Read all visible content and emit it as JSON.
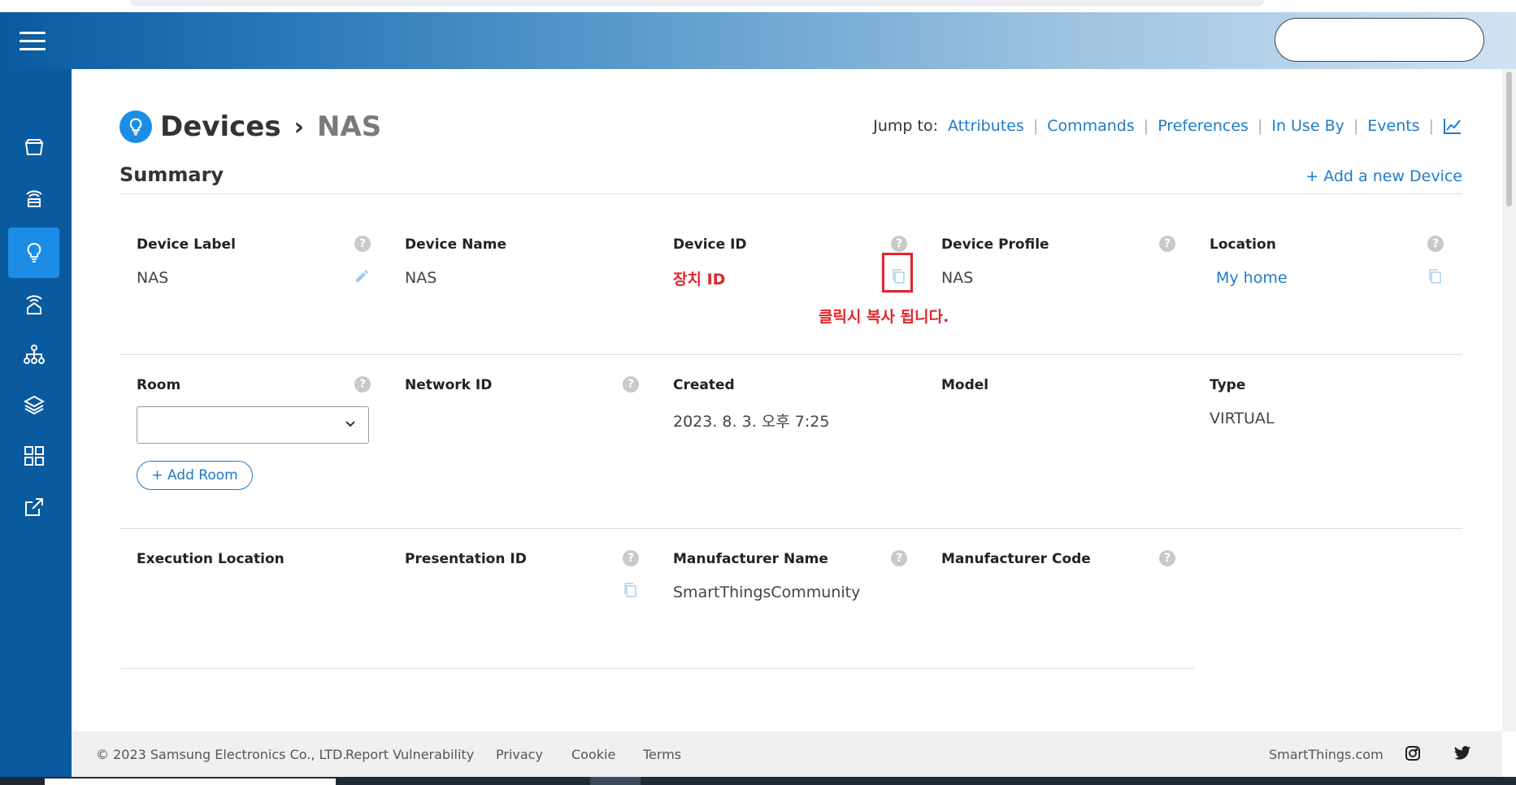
{
  "title": {
    "section": "Devices",
    "separator": "›",
    "device": "NAS"
  },
  "jump": {
    "label": "Jump to:",
    "links": [
      "Attributes",
      "Commands",
      "Preferences",
      "In Use By",
      "Events"
    ]
  },
  "summary": {
    "heading": "Summary",
    "add_new": "+ Add a new Device"
  },
  "fields": {
    "device_label": {
      "label": "Device Label",
      "value": "NAS"
    },
    "device_name": {
      "label": "Device Name",
      "value": "NAS"
    },
    "device_id": {
      "label": "Device ID",
      "value": "장치 ID"
    },
    "device_profile": {
      "label": "Device Profile",
      "value": "NAS"
    },
    "location": {
      "label": "Location",
      "value": "My home"
    },
    "room": {
      "label": "Room",
      "value": ""
    },
    "network_id": {
      "label": "Network ID",
      "value": ""
    },
    "created": {
      "label": "Created",
      "value": "2023. 8. 3. 오후 7:25"
    },
    "model": {
      "label": "Model",
      "value": ""
    },
    "type": {
      "label": "Type",
      "value": "VIRTUAL"
    },
    "execution_location": {
      "label": "Execution Location",
      "value": ""
    },
    "presentation_id": {
      "label": "Presentation ID",
      "value": ""
    },
    "manufacturer_name": {
      "label": "Manufacturer Name",
      "value": "SmartThingsCommunity"
    },
    "manufacturer_code": {
      "label": "Manufacturer Code",
      "value": ""
    }
  },
  "annotation": {
    "text": "클릭시 복사 됩니다."
  },
  "add_room": "+ Add Room",
  "help_glyph": "?",
  "footer": {
    "copyright": "© 2023 Samsung Electronics Co., LTD.",
    "links": [
      "Report Vulnerability",
      "Privacy",
      "Cookie",
      "Terms"
    ],
    "site": "SmartThings.com"
  },
  "colors": {
    "sidebar": "#0a5aa0",
    "active": "#1b8de6",
    "link": "#1f7bc8",
    "annotation_red": "#e0262a"
  },
  "icons": [
    "hamburger-icon",
    "box-icon",
    "hub-icon",
    "bulb-icon",
    "home-signal-icon",
    "network-icon",
    "layers-icon",
    "apps-icon",
    "external-link-icon",
    "copy-icon",
    "pencil-icon",
    "help-icon",
    "chart-icon",
    "instagram-icon",
    "twitter-icon"
  ]
}
